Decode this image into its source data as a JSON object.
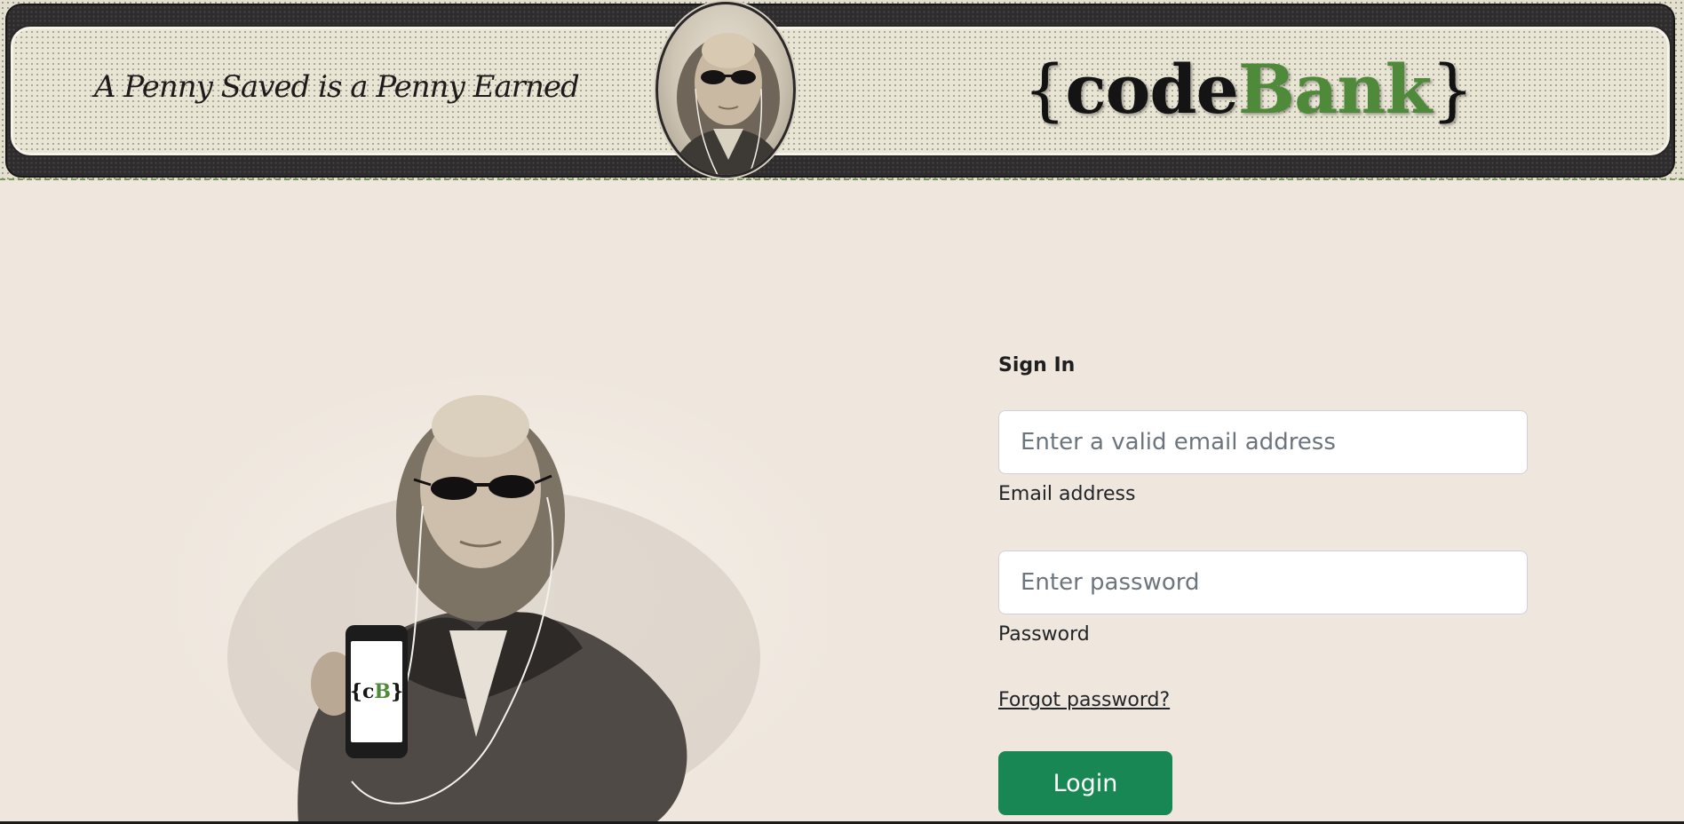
{
  "header": {
    "motto": "A Penny Saved is a Penny Earned",
    "logo": {
      "open_brace": "{",
      "code": "code",
      "bank": "Bank",
      "close_brace": "}"
    }
  },
  "hero": {
    "phone_logo": {
      "open": "{c",
      "b": "B",
      "close": "}"
    }
  },
  "form": {
    "title": "Sign In",
    "email": {
      "placeholder": "Enter a valid email address",
      "label": "Email address",
      "value": ""
    },
    "password": {
      "placeholder": "Enter password",
      "label": "Password",
      "value": ""
    },
    "forgot_label": "Forgot password?",
    "login_label": "Login"
  },
  "colors": {
    "page_bg": "#efe6dd",
    "brand_green": "#4f8a3a",
    "login_button": "#198754",
    "banner_dark": "#2f2c2d"
  }
}
